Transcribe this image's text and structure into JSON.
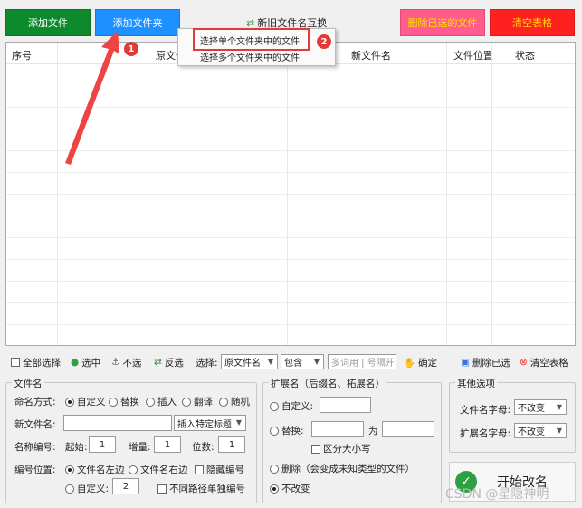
{
  "colors": {
    "add_file_green": "#0c8a2c",
    "add_folder_blue": "#1e90ff",
    "delete_pink": "#ff5c8d",
    "clear_red": "#ff2020",
    "highlight_red": "#e53935"
  },
  "top_buttons": {
    "add_file": "添加文件",
    "add_folder": "添加文件夹",
    "swap_names": "新旧文件名互换",
    "delete_selected": "删除已选的文件",
    "clear_table": "清空表格"
  },
  "dropdown_menu": {
    "item_single": "选择单个文件夹中的文件",
    "item_multiple": "选择多个文件夹中的文件"
  },
  "badges": {
    "b1": "1",
    "b2": "2"
  },
  "table": {
    "columns": [
      "序号",
      "原文件名",
      "新文件名",
      "文件位置",
      "状态"
    ]
  },
  "toolbar": {
    "select_all": "全部选择",
    "select_checked": "选中",
    "unselect": "不选",
    "invert": "反选",
    "select_label": "选择:",
    "select_field": "原文件名",
    "select_mode": "包含",
    "keyword_placeholder": "多词用 | 号隔开",
    "confirm": "确定",
    "delete_selected": "删除已选",
    "clear_table": "清空表格"
  },
  "filename_group": {
    "title": "文件名",
    "naming_label": "命名方式:",
    "modes": [
      "自定义",
      "替换",
      "插入",
      "翻译",
      "随机"
    ],
    "new_name_label": "新文件名:",
    "new_name_value": "",
    "insert_title_option": "插入特定标题",
    "numbering_label": "名称编号:",
    "start_label": "起始:",
    "start_value": "1",
    "step_label": "增量:",
    "step_value": "1",
    "digits_label": "位数:",
    "digits_value": "1",
    "position_label": "编号位置:",
    "position_left": "文件名左边",
    "position_right": "文件名右边",
    "hide_number": "隐藏编号",
    "custom_label": "自定义:",
    "custom_value": "2",
    "separate_number": "不同路径单独编号"
  },
  "extension_group": {
    "title": "扩展名（后缀名、拓展名）",
    "custom_label": "自定义:",
    "replace_label": "替换:",
    "for_label": "为",
    "case_sensitive": "区分大小写",
    "delete_label": "删除（会变成未知类型的文件）",
    "unchanged_label": "不改变"
  },
  "other_group": {
    "title": "其他选项",
    "filename_case_label": "文件名字母:",
    "filename_case_value": "不改变",
    "ext_case_label": "扩展名字母:",
    "ext_case_value": "不改变"
  },
  "start_button": "开始改名",
  "watermark": "CSDN @星隐神明"
}
